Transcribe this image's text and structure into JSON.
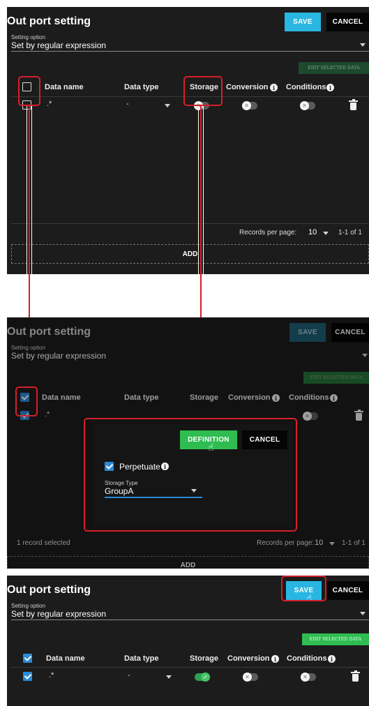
{
  "title": "Out port setting",
  "save_label": "SAVE",
  "cancel_label": "CANCEL",
  "setting_option": {
    "label": "Setting option",
    "value": "Set by regular expression"
  },
  "edit_selected_label": "EDIT SELECTED DATA",
  "columns": {
    "data_name": "Data name",
    "data_type": "Data type",
    "storage": "Storage",
    "conversion": "Conversion",
    "conditions": "Conditions"
  },
  "row": {
    "data_name": ".*",
    "data_type": "-"
  },
  "pagination": {
    "records_per_page_label": "Records per page:",
    "records_per_page_value": "10",
    "range": "1-1 of 1"
  },
  "add_label": "ADD",
  "selection_status": "1 record selected",
  "popup": {
    "definition_label": "DEFINITION",
    "cancel_label": "CANCEL",
    "perpetuate_label": "Perpetuate",
    "storage_type_label": "Storage Type",
    "storage_type_value": "GroupA"
  },
  "icons": {
    "info": "info-icon",
    "trash": "trash-icon",
    "caret": "chevron-down-icon",
    "pointer": "hand-pointer-icon"
  },
  "colors": {
    "save": "#29b6e2",
    "edit_selected": "#2fbd51",
    "highlight": "#d51f2b",
    "checkbox_checked": "#2a8ad7",
    "toggle_on": "#47c66a"
  },
  "states": {
    "step1": {
      "row_checked": false,
      "storage_on": false
    },
    "step2": {
      "row_checked": true,
      "storage_on": false
    },
    "step3": {
      "row_checked": true,
      "storage_on": true
    }
  }
}
